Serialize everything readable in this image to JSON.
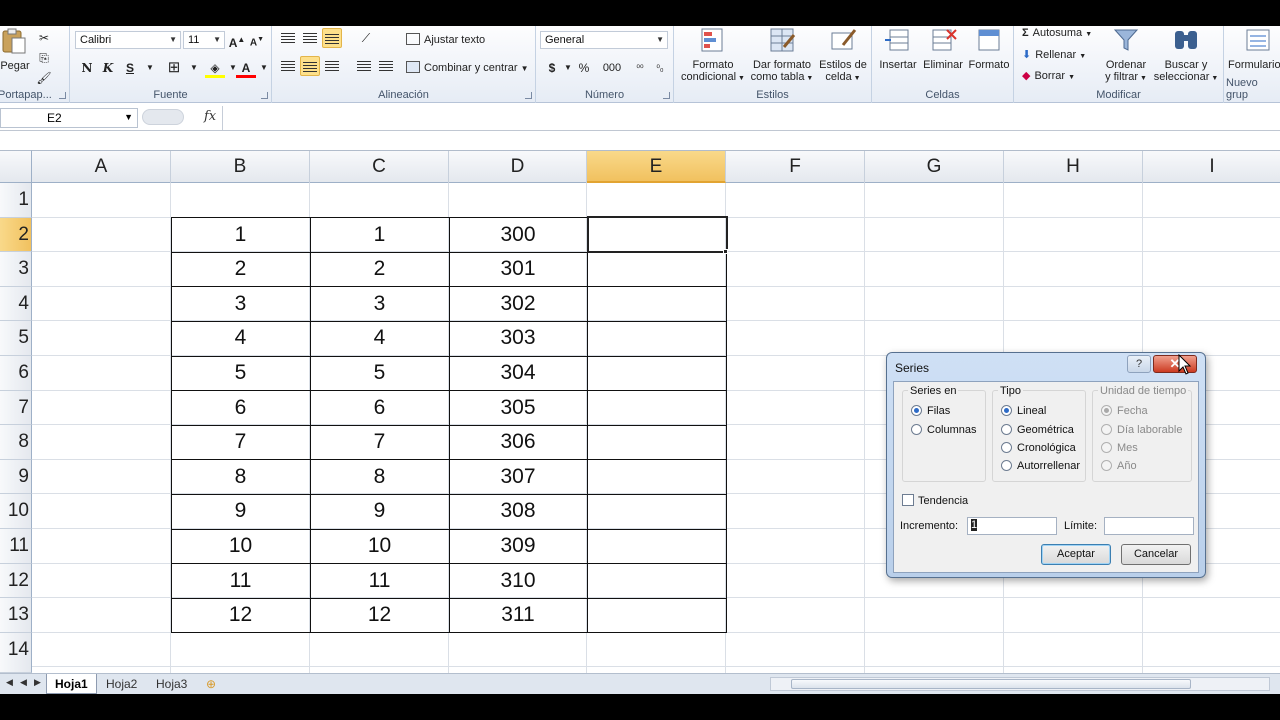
{
  "ribbon": {
    "clipboard": {
      "paste_label": "Pegar",
      "group_label": "Portapap..."
    },
    "font": {
      "name": "Calibri",
      "size": "11",
      "bold": "N",
      "italic": "K",
      "underline": "S",
      "group_label": "Fuente"
    },
    "alignment": {
      "wrap_text": "Ajustar texto",
      "merge_center": "Combinar y centrar",
      "group_label": "Alineación"
    },
    "number": {
      "format": "General",
      "currency": "$",
      "percent": "%",
      "thousands": "000",
      "group_label": "Número"
    },
    "styles": {
      "conditional_format_1": "Formato",
      "conditional_format_2": "condicional",
      "format_table_1": "Dar formato",
      "format_table_2": "como tabla",
      "cell_styles_1": "Estilos de",
      "cell_styles_2": "celda",
      "group_label": "Estilos"
    },
    "cells": {
      "insert": "Insertar",
      "delete": "Eliminar",
      "format": "Formato",
      "group_label": "Celdas"
    },
    "editing": {
      "autosum": "Autosuma",
      "fill": "Rellenar",
      "clear": "Borrar",
      "sort_filter_1": "Ordenar",
      "sort_filter_2": "y filtrar",
      "find_select_1": "Buscar y",
      "find_select_2": "seleccionar",
      "group_label": "Modificar"
    },
    "new_group": {
      "forms": "Formulario",
      "group_label": "Nuevo grup"
    }
  },
  "formula_bar": {
    "name_box": "E2",
    "fx": "fx",
    "value": ""
  },
  "columns": [
    "A",
    "B",
    "C",
    "D",
    "E",
    "F",
    "G",
    "H",
    "I"
  ],
  "selected_column": "E",
  "rows": [
    "1",
    "2",
    "3",
    "4",
    "5",
    "6",
    "7",
    "8",
    "9",
    "10",
    "11",
    "12",
    "13",
    "14"
  ],
  "selected_row": "2",
  "table": [
    [
      "1",
      "1",
      "300"
    ],
    [
      "2",
      "2",
      "301"
    ],
    [
      "3",
      "3",
      "302"
    ],
    [
      "4",
      "4",
      "303"
    ],
    [
      "5",
      "5",
      "304"
    ],
    [
      "6",
      "6",
      "305"
    ],
    [
      "7",
      "7",
      "306"
    ],
    [
      "8",
      "8",
      "307"
    ],
    [
      "9",
      "9",
      "308"
    ],
    [
      "10",
      "10",
      "309"
    ],
    [
      "11",
      "11",
      "310"
    ],
    [
      "12",
      "12",
      "311"
    ]
  ],
  "sheets": [
    {
      "label": "Hoja1",
      "active": true
    },
    {
      "label": "Hoja2",
      "active": false
    },
    {
      "label": "Hoja3",
      "active": false
    }
  ],
  "dialog": {
    "title": "Series",
    "help": "?",
    "close": "✕",
    "series_in": {
      "legend": "Series en",
      "options": [
        "Filas",
        "Columnas"
      ],
      "selected": "Filas"
    },
    "type": {
      "legend": "Tipo",
      "options": [
        "Lineal",
        "Geométrica",
        "Cronológica",
        "Autorrellenar"
      ],
      "selected": "Lineal"
    },
    "date_unit": {
      "legend": "Unidad de tiempo",
      "options": [
        "Fecha",
        "Día laborable",
        "Mes",
        "Año"
      ],
      "selected": "Fecha",
      "disabled": true
    },
    "trend_label": "Tendencia",
    "increment_label": "Incremento:",
    "increment_value": "1",
    "limit_label": "Límite:",
    "limit_value": "",
    "ok": "Aceptar",
    "cancel": "Cancelar"
  }
}
